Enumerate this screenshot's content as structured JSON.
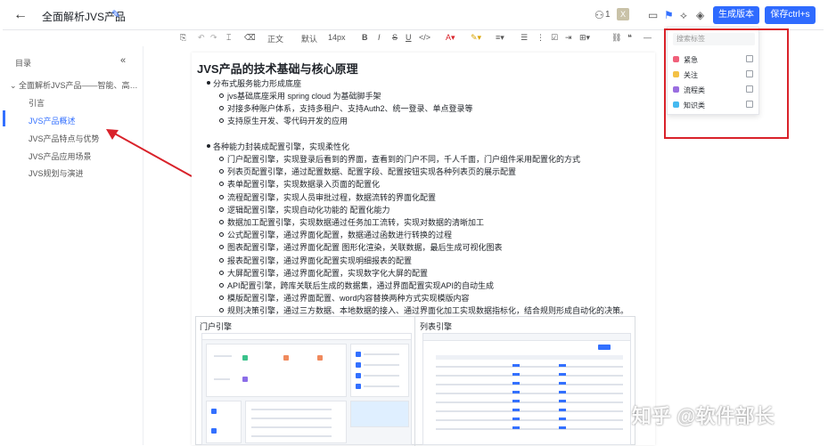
{
  "header": {
    "back_label": "←",
    "title": "全面解析JVS产品",
    "collab_count": "1",
    "avatar_letter": "X",
    "generate_button": "生成版本",
    "save_button": "保存ctrl+s"
  },
  "format_toolbar": {
    "style": "正文",
    "font": "默认",
    "size": "14px",
    "bold": "B",
    "italic": "I",
    "strike": "S",
    "underline": "U"
  },
  "sidebar": {
    "title": "目录",
    "collapse": "«",
    "items": [
      {
        "label": "全面解析JVS产品——智能、高…",
        "level": 0
      },
      {
        "label": "引言",
        "level": 1
      },
      {
        "label": "JVS产品概述",
        "level": 1,
        "active": true
      },
      {
        "label": "JVS产品特点与优势",
        "level": 1
      },
      {
        "label": "JVS产品应用场景",
        "level": 1
      },
      {
        "label": "JVS规划与演进",
        "level": 1
      }
    ]
  },
  "document": {
    "heading": "JVS产品的技术基础与核心原理",
    "section1": {
      "bullet": "分布式服务能力形成底座",
      "subs": [
        "jvs基础底座采用 spring cloud 为基础脚手架",
        "对接多种账户体系，支持多租户、支持Auth2、统一登录、单点登录等",
        "支持原生开发、零代码开发的应用"
      ]
    },
    "section2": {
      "bullet": "各种能力封装成配置引擎，实现柔性化",
      "subs": [
        "门户配置引擎，实现登录后看到的界面，查看到的门户不同，千人千面，门户组件采用配置化的方式",
        "列表页配置引擎，通过配置数据、配置字段、配置按钮实现各种列表页的展示配置",
        "表单配置引擎，实现数据录入页面的配置化",
        "流程配置引擎，实现人员审批过程，数据流转的界面化配置",
        "逻辑配置引擎，实现自动化功能的 配置化能力",
        "数据加工配置引擎，实现数据通过任务加工流转，实现对数据的清晰加工",
        "公式配置引擎，通过界面化配置，数据通过函数进行转换的过程",
        "图表配置引擎，通过界面化配置 图形化渲染，关联数据，最后生成可视化图表",
        "报表配置引擎，通过界面化配置实现明细报表的配置",
        "大屏配置引擎，通过界面化配置，实现数字化大屏的配置",
        "API配置引擎，跨库关联后生成的数据集，通过界面配置实现API的自动生成",
        "模版配置引擎，通过界面配置、word内容替换两种方式实现模版内容",
        "规则决策引擎，通过三方数据、本地数据的接入、通过界面化加工实现数据指标化，结合规则形成自动化的决策。"
      ]
    },
    "images": {
      "left_caption": "门户引擎",
      "right_caption": "列表引擎"
    }
  },
  "tag_popup": {
    "search_placeholder": "搜索标签",
    "tags": [
      {
        "label": "紧急",
        "color": "#f0607a"
      },
      {
        "label": "关注",
        "color": "#f3c146"
      },
      {
        "label": "流程类",
        "color": "#9a6ee0"
      },
      {
        "label": "知识类",
        "color": "#45b9f0"
      }
    ]
  },
  "watermark": "知乎 @软件部长",
  "colors": {
    "accent": "#2f6bff",
    "annotation": "#d9222a"
  }
}
